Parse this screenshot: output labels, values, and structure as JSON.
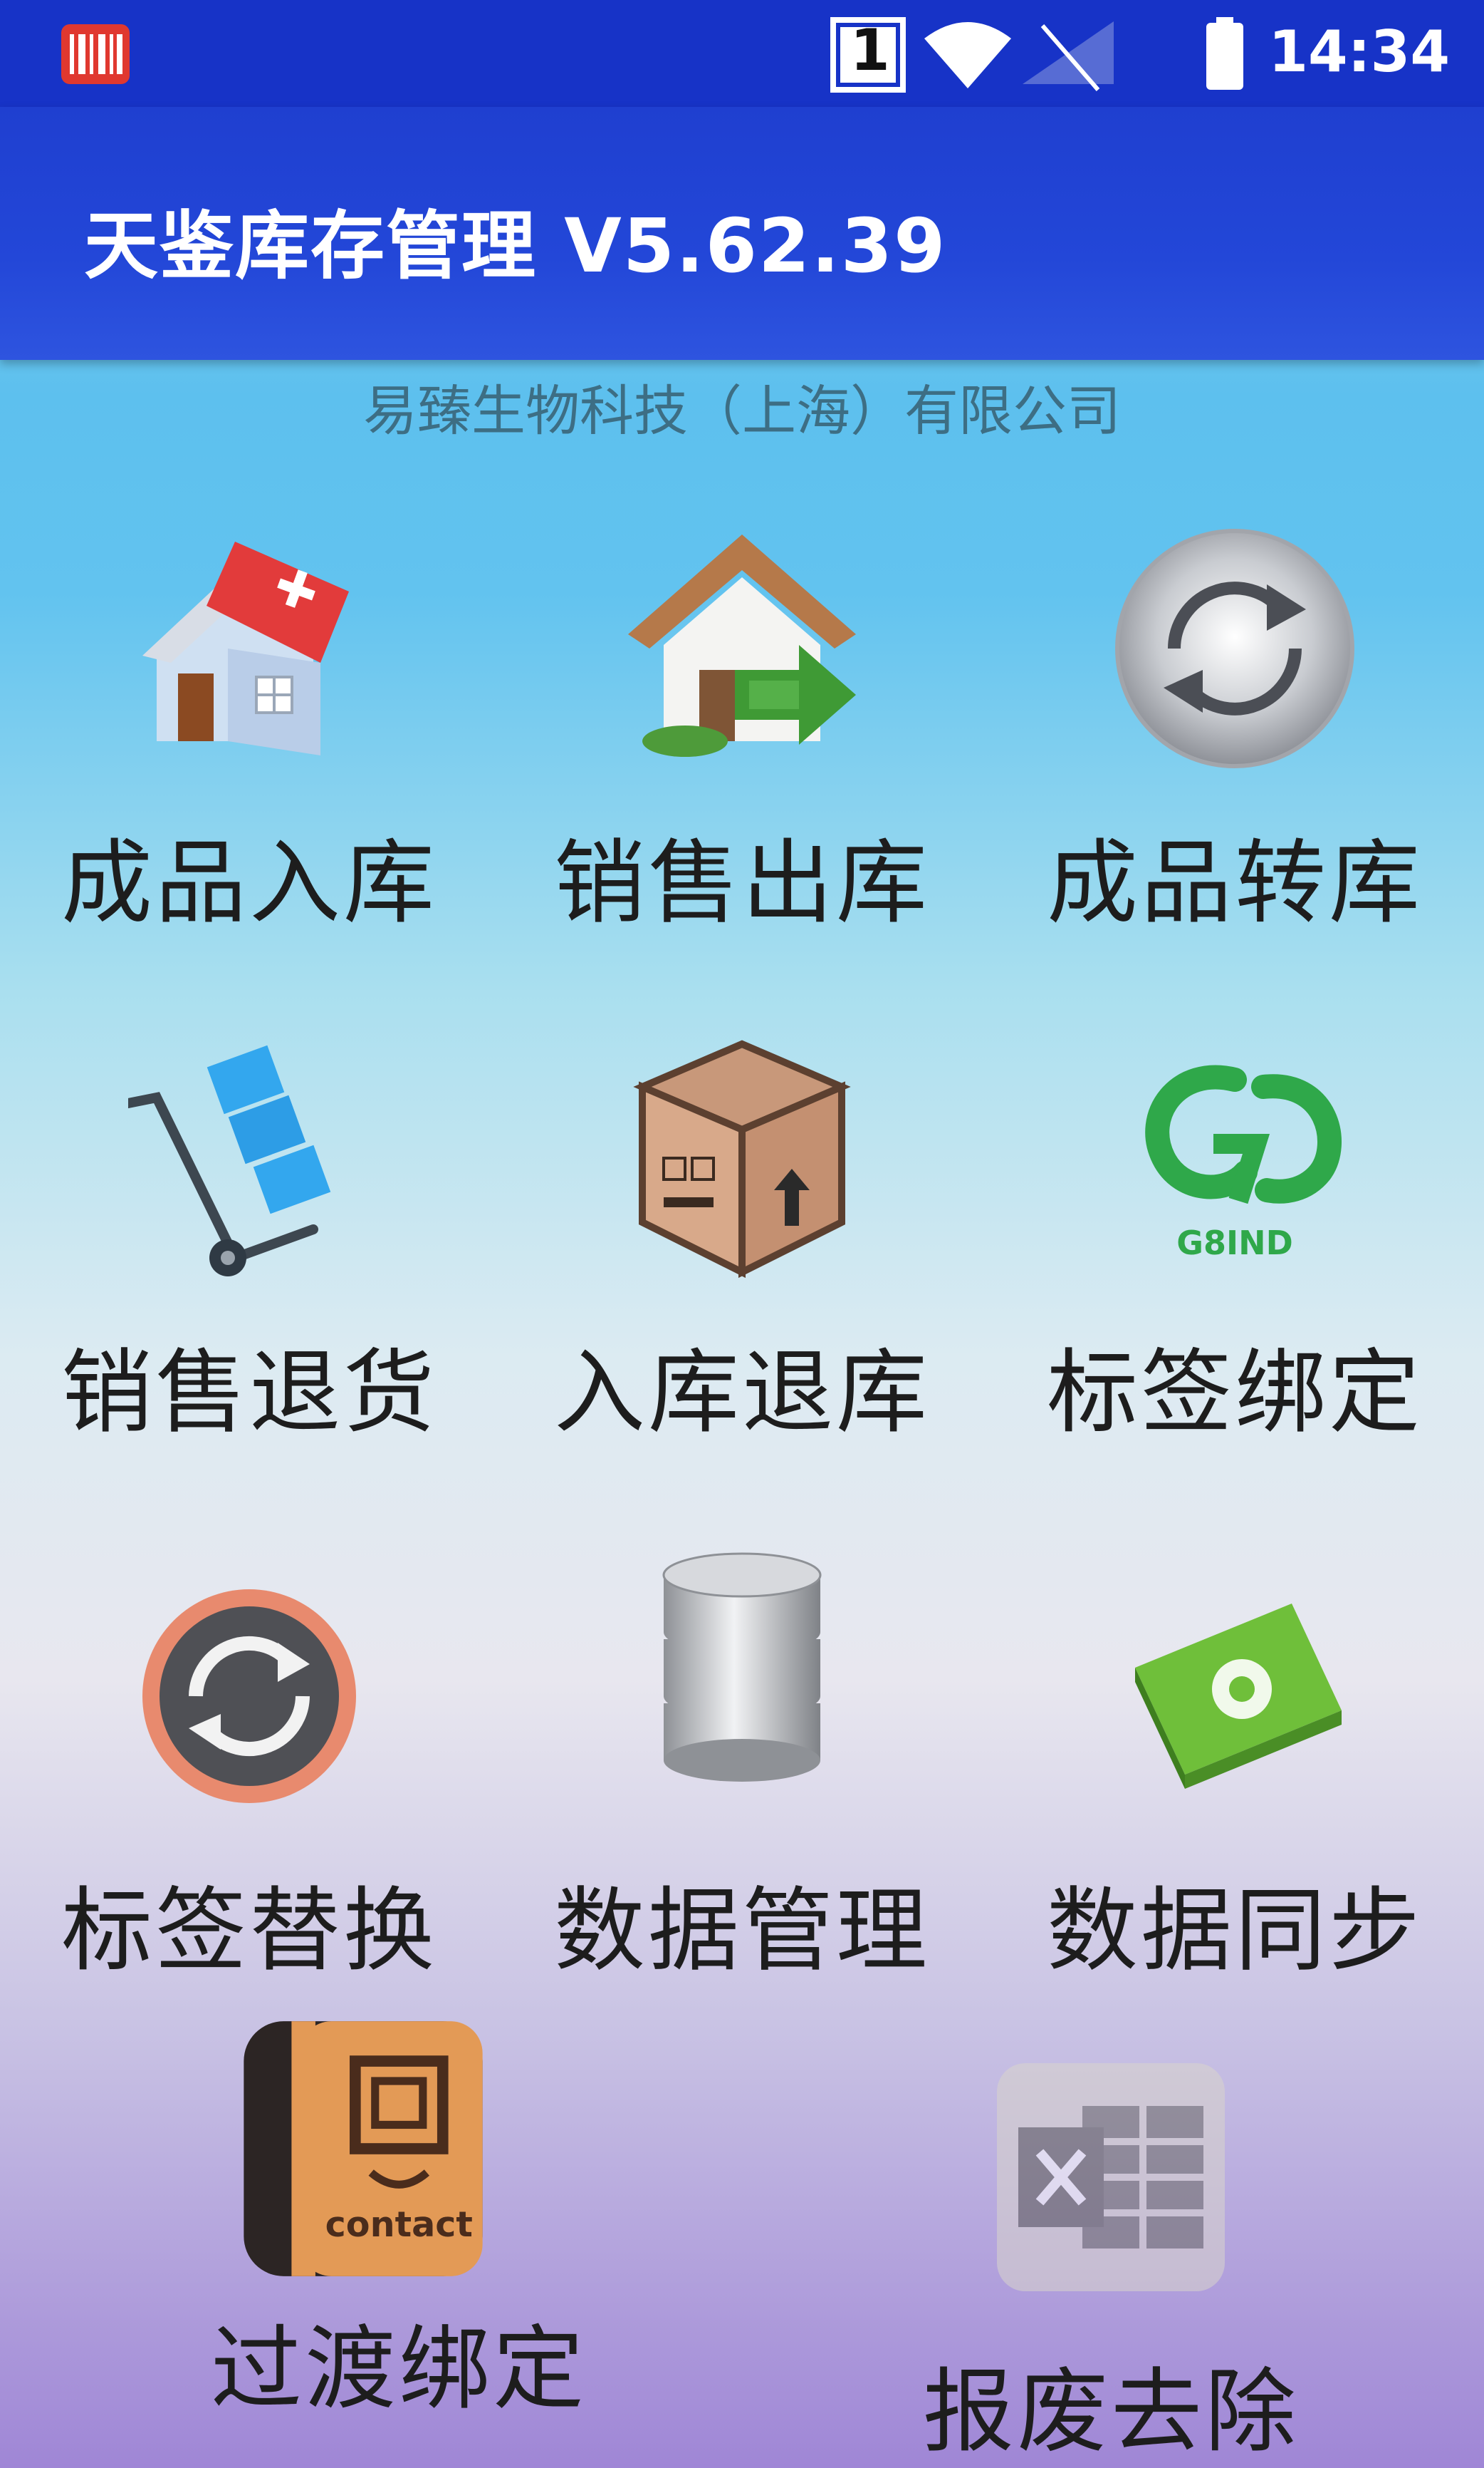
{
  "status_bar": {
    "time": "14:34",
    "sim_slot": "1",
    "icons": [
      "barcode-app-icon",
      "sim-1-icon",
      "wifi-icon",
      "signal-icon",
      "battery-icon"
    ]
  },
  "app_bar": {
    "title": "天鉴库存管理 V5.62.39"
  },
  "company": "易臻生物科技（上海）有限公司",
  "menu": [
    {
      "label": "成品入库",
      "icon": "house-add-icon"
    },
    {
      "label": "销售出库",
      "icon": "house-out-arrow-icon"
    },
    {
      "label": "成品转库",
      "icon": "refresh-circle-icon"
    },
    {
      "label": "销售退货",
      "icon": "hand-truck-icon"
    },
    {
      "label": "入库退库",
      "icon": "cardboard-box-icon"
    },
    {
      "label": "标签绑定",
      "icon": "g8ind-logo-icon",
      "logo_text": "G8IND"
    },
    {
      "label": "标签替换",
      "icon": "swap-circle-icon"
    },
    {
      "label": "数据管理",
      "icon": "database-icon"
    },
    {
      "label": "数据同步",
      "icon": "recycle-folder-icon"
    },
    {
      "label": "过渡绑定",
      "icon": "contact-book-icon",
      "icon_text": "contact"
    },
    {
      "label": "报废去除",
      "icon": "excel-sheet-icon"
    }
  ],
  "colors": {
    "app_bar": "#2347d8",
    "status_bar": "#1733c7",
    "label_text": "#1d1d1d",
    "company_text": "#3d6e84"
  }
}
